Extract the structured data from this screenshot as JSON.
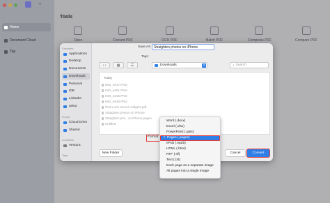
{
  "app": {
    "sidebar": {
      "items": [
        {
          "label": "Home"
        },
        {
          "label": "Document Cloud"
        },
        {
          "label": "Tag"
        }
      ]
    },
    "main": {
      "title": "Tools",
      "tools": [
        "Open",
        "Convert PDF",
        "OCR PDF",
        "Batch PDF",
        "Compress PDF",
        "Compare PDF"
      ]
    }
  },
  "dialog": {
    "save_as_label": "Save As:",
    "save_as_value": "Straighten photos on iPhone",
    "tags_label": "Tags:",
    "location": "Downloads",
    "search_placeholder": "Search",
    "sidebar": {
      "favorites_header": "Favorites",
      "favorites": [
        "Applications",
        "Desktop",
        "Documents",
        "Downloads",
        "Personal",
        "IDB",
        "LinkedIn",
        "ankur"
      ],
      "icloud_header": "iCloud",
      "icloud": [
        "iCloud Drive",
        "Shared"
      ],
      "locations_header": "Locations",
      "locations": [
        "Ventura"
      ],
      "tags_header": "Tags"
    },
    "list_header": "Today",
    "files": [
      "IMG_6017.PNG",
      "IMG_6351.PNG",
      "IMG_6436.PNG",
      "IMG_6635.PNG",
      "iPad Lock Screen widgets.pdf",
      "Straighten photos on iPhone",
      "Straighten pho...on iPhone.pages",
      "Untitled"
    ],
    "format_label": "Format",
    "new_folder": "New Folder",
    "cancel": "Cancel",
    "convert": "Convert"
  },
  "format_menu": {
    "selected": "Pages (.pages)",
    "options": [
      "Word (.docx)",
      "Excel (.xlsx)",
      "PowerPoint (.pptx)",
      "Pages (.pages)",
      "ePub (.epub)",
      "HTML (.html)",
      "RTF (.rtf)",
      "Text (.txt)",
      "Each page as a separate image",
      "All pages into a single image"
    ]
  },
  "colors": {
    "accent": "#2f7fe6",
    "highlight": "#e53935"
  }
}
